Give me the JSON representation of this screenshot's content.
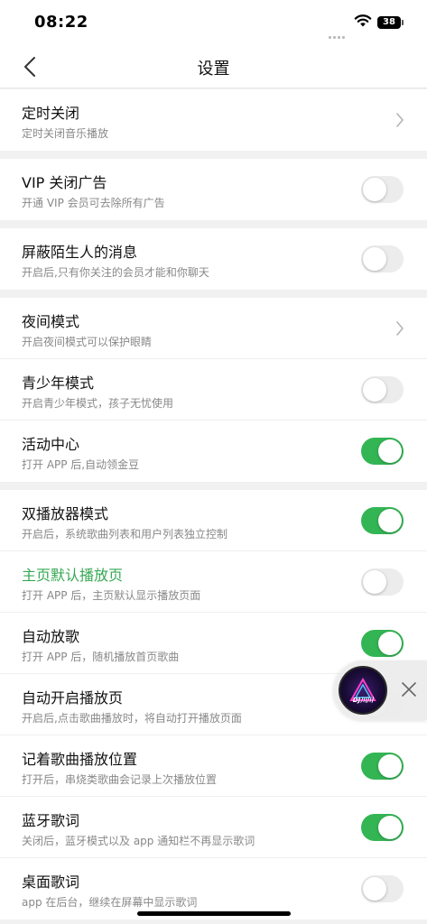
{
  "status": {
    "time": "08:22",
    "battery": "38"
  },
  "nav": {
    "title": "设置"
  },
  "groups": [
    [
      {
        "title": "定时关闭",
        "subtitle": "定时关闭音乐播放",
        "control": "chevron"
      }
    ],
    [
      {
        "title": "VIP 关闭广告",
        "subtitle": "开通 VIP 会员可去除所有广告",
        "control": "toggle",
        "on": false
      }
    ],
    [
      {
        "title": "屏蔽陌生人的消息",
        "subtitle": "开启后,只有你关注的会员才能和你聊天",
        "control": "toggle",
        "on": false
      }
    ],
    [
      {
        "title": "夜间模式",
        "subtitle": "开启夜间模式可以保护眼睛",
        "control": "chevron"
      },
      {
        "title": "青少年模式",
        "subtitle": "开启青少年模式，孩子无忧使用",
        "control": "toggle",
        "on": false
      },
      {
        "title": "活动中心",
        "subtitle": "打开 APP 后,自动领金豆",
        "control": "toggle",
        "on": true
      }
    ],
    [
      {
        "title": "双播放器模式",
        "subtitle": "开启后，系统歌曲列表和用户列表独立控制",
        "control": "toggle",
        "on": true
      },
      {
        "title": "主页默认播放页",
        "subtitle": "打开 APP 后，主页默认显示播放页面",
        "control": "toggle",
        "on": false,
        "accent": true
      },
      {
        "title": "自动放歌",
        "subtitle": "打开 APP 后，随机播放首页歌曲",
        "control": "toggle",
        "on": true
      },
      {
        "title": "自动开启播放页",
        "subtitle": "开启后,点击歌曲播放时，将自动打开播放页面",
        "control": "toggle",
        "on": false
      },
      {
        "title": "记着歌曲播放位置",
        "subtitle": "打开后，串烧类歌曲会记录上次播放位置",
        "control": "toggle",
        "on": true
      },
      {
        "title": "蓝牙歌词",
        "subtitle": "关闭后，蓝牙模式以及 app 通知栏不再显示歌词",
        "control": "toggle",
        "on": true
      },
      {
        "title": "桌面歌词",
        "subtitle": "app 在后台，继续在屏幕中显示歌词",
        "control": "toggle",
        "on": false
      }
    ]
  ],
  "float_player": {
    "disc_label": "DJ川川"
  },
  "colors": {
    "accent": "#33b554",
    "accent_text": "#35a853",
    "toggle_off": "#ececec",
    "background": "#f1f1f1"
  }
}
